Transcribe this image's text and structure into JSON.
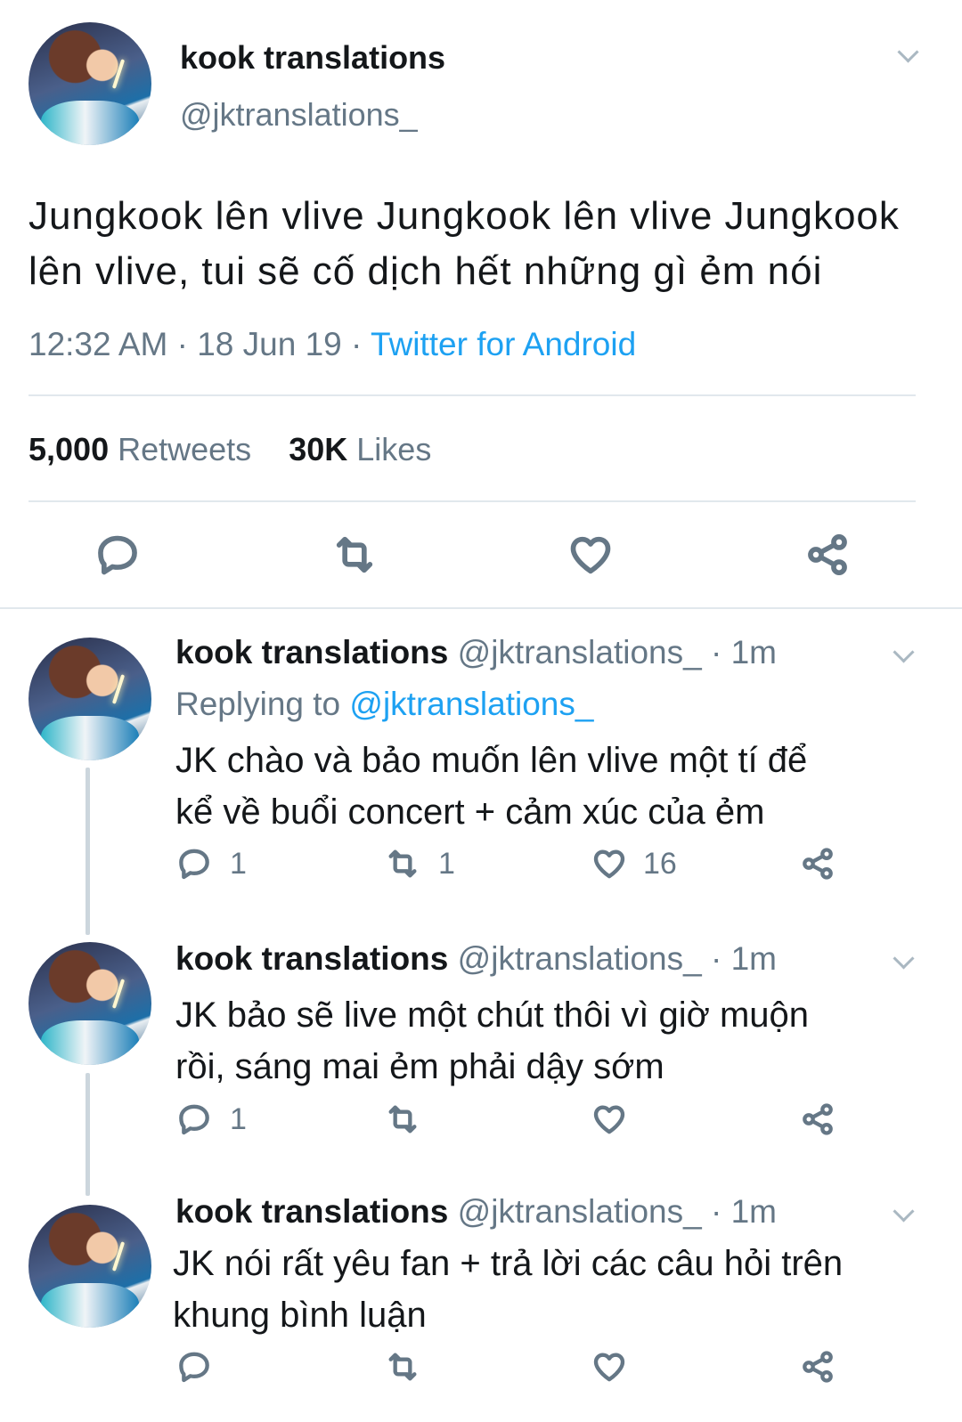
{
  "main_tweet": {
    "display_name": "kook translations",
    "handle": "@jktranslations_",
    "text_line1": "Jungkook lên vlive Jungkook lên vlive Jungkook",
    "text_line2": "lên vlive, tui sẽ cố dịch hết những gì ẻm nói",
    "time": "12:32 AM",
    "date": "18 Jun 19",
    "separator": "·",
    "source": "Twitter for Android",
    "retweets_count": "5,000",
    "retweets_label": "Retweets",
    "likes_count": "30K",
    "likes_label": "Likes"
  },
  "replies": [
    {
      "display_name": "kook translations",
      "handle": "@jktranslations_",
      "time": "· 1m",
      "replying_label": "Replying to",
      "replying_handle": "@jktranslations_",
      "line1": "JK chào và bảo muốn lên vlive một tí để",
      "line2": "kể về buổi concert + cảm xúc của ẻm",
      "replies": "1",
      "retweets": "1",
      "likes": "16"
    },
    {
      "display_name": "kook translations",
      "handle": "@jktranslations_",
      "time": "· 1m",
      "line1": "JK bảo sẽ live một chút thôi vì giờ muộn",
      "line2": "rồi, sáng mai ẻm phải dậy sớm",
      "replies": "1",
      "retweets": "",
      "likes": ""
    },
    {
      "display_name": "kook translations",
      "handle": "@jktranslations_",
      "time": "· 1m",
      "line1": "JK nói rất yêu fan + trả lời các câu hỏi trên",
      "line2": "khung bình luận",
      "replies": "",
      "retweets": "",
      "likes": ""
    }
  ],
  "colors": {
    "link": "#1da1f2",
    "muted": "#657786",
    "divider": "#e1e8ed"
  },
  "icons": [
    "reply-icon",
    "retweet-icon",
    "like-icon",
    "share-icon",
    "chevron-down-icon"
  ]
}
